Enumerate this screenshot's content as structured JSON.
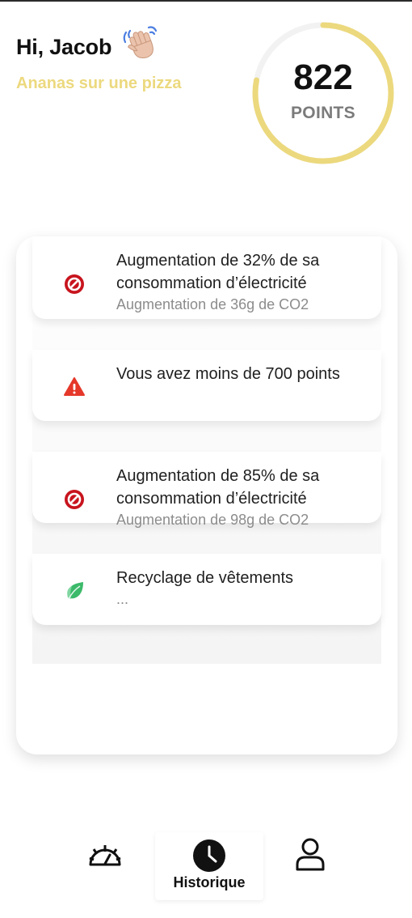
{
  "header": {
    "greeting": "Hi, Jacob",
    "subtitle": "Ananas sur une pizza",
    "wave_icon": "waving-hand-icon"
  },
  "points": {
    "value": "822",
    "label": "POINTS",
    "progress_fraction": 0.78,
    "ring_color": "#ecd97e",
    "ring_track_color": "#f2f2f2"
  },
  "history": {
    "items": [
      {
        "icon": "prohibited-icon",
        "icon_color": "#c8141e",
        "title": "Augmentation de 32% de sa consommation d’électricité",
        "subtitle": "Augmentation de 36g de CO2"
      },
      {
        "icon": "warning-icon",
        "icon_color": "#e5382a",
        "title": "Vous avez moins de 700 points",
        "subtitle": ""
      },
      {
        "icon": "prohibited-icon",
        "icon_color": "#c8141e",
        "title": "Augmentation de 85% de sa consommation d’électricité",
        "subtitle": "Augmentation de 98g de CO2"
      },
      {
        "icon": "leaf-icon",
        "icon_color": "#3cba6a",
        "title": "Recyclage de vêtements",
        "subtitle": "..."
      }
    ]
  },
  "nav": {
    "items": [
      {
        "icon": "dashboard-gauge-icon",
        "label": ""
      },
      {
        "icon": "clock-icon",
        "label": "Historique",
        "active": true
      },
      {
        "icon": "user-icon",
        "label": ""
      }
    ]
  }
}
